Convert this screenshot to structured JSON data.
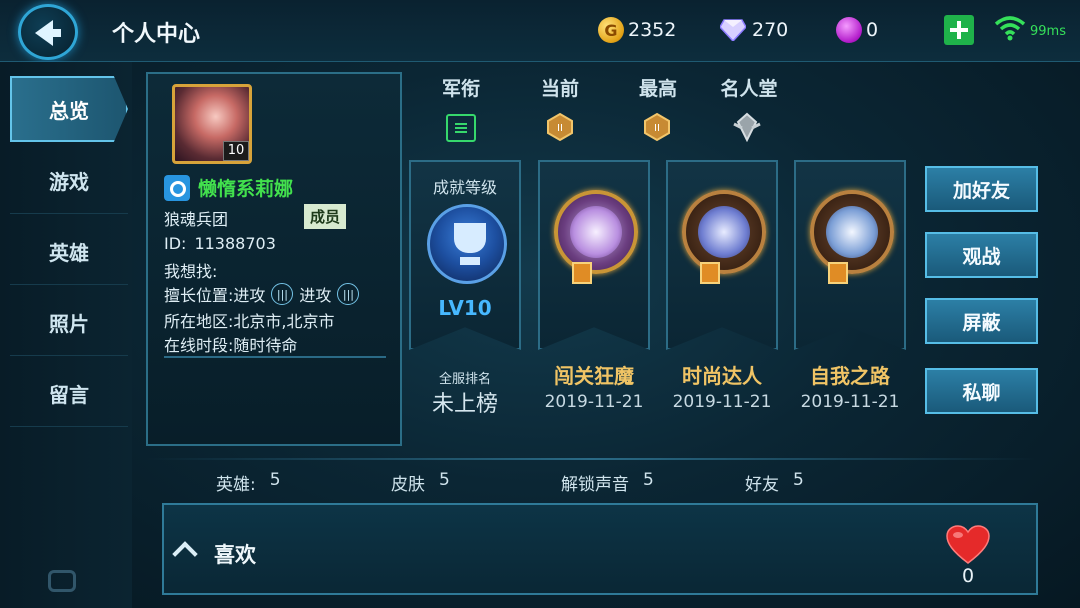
{
  "header": {
    "title": "个人中心",
    "gold": "2352",
    "diamonds": "270",
    "gems": "0",
    "ping": "99ms"
  },
  "sidebar": {
    "items": [
      {
        "label": "总览",
        "active": true
      },
      {
        "label": "游戏"
      },
      {
        "label": "英雄"
      },
      {
        "label": "照片"
      },
      {
        "label": "留言"
      }
    ]
  },
  "player": {
    "level": "10",
    "name": "懒惰系莉娜",
    "guild": "狼魂兵团",
    "guild_role": "成员",
    "id_label": "ID:",
    "id_value": "11388703",
    "looking_for_label": "我想找:",
    "position_label": "擅长位置:",
    "position_1": "进攻",
    "position_2": "进攻",
    "region_label": "所在地区:",
    "region_value": "北京市,北京市",
    "online_label": "在线时段:",
    "online_value": "随时待命"
  },
  "rank_header": {
    "junxian": "军衔",
    "current": "当前",
    "highest": "最高",
    "hall_of_fame": "名人堂"
  },
  "achievement_level": {
    "title": "成就等级",
    "level": "LV10",
    "rank_label": "全服排名",
    "rank_value": "未上榜"
  },
  "achievements": [
    {
      "name": "闯关狂魔",
      "date": "2019-11-21"
    },
    {
      "name": "时尚达人",
      "date": "2019-11-21"
    },
    {
      "name": "自我之路",
      "date": "2019-11-21"
    }
  ],
  "actions": {
    "add_friend": "加好友",
    "spectate": "观战",
    "block": "屏蔽",
    "private_chat": "私聊"
  },
  "stats": {
    "heroes_label": "英雄:",
    "heroes_value": "5",
    "skins_label": "皮肤",
    "skins_value": "5",
    "voices_label": "解锁声音",
    "voices_value": "5",
    "friends_label": "好友",
    "friends_value": "5"
  },
  "likes": {
    "label": "喜欢",
    "count": "0"
  }
}
